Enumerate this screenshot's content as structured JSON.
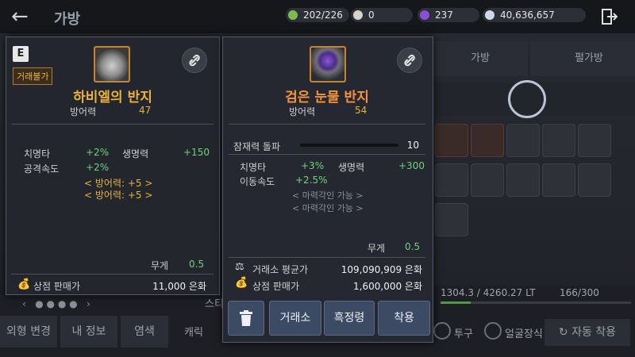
{
  "header": {
    "title": "가방",
    "currencies": [
      {
        "name": "weight-currency",
        "value": "202/226",
        "color": "#7dbb4e"
      },
      {
        "name": "pearl-currency",
        "value": "0",
        "color": "#d9d2c8"
      },
      {
        "name": "gem-currency",
        "value": "237",
        "color": "#8a4fd6"
      },
      {
        "name": "silver-currency",
        "value": "40,636,657",
        "color": "#cfd8e6"
      }
    ]
  },
  "inventory": {
    "tabs": [
      "가방",
      "펄가방"
    ],
    "weight": "1304.3 / 4260.27 LT",
    "slots": "166/300"
  },
  "bottom": {
    "buttons": [
      "외형 변경",
      "내 정보",
      "염색"
    ],
    "auto_equip": "자동 착용",
    "check_labels": [
      "투구",
      "얼굴장식"
    ],
    "partial": [
      "캐릭",
      "스티"
    ]
  },
  "left_item": {
    "grade": "E",
    "trade_badge": "거래불가",
    "name": "하비엘의 반지",
    "name_color": "#e8b23a",
    "defense_label": "방어력",
    "defense_value": "47",
    "stats": [
      {
        "label": "치명타",
        "value": "+2%"
      },
      {
        "label": "생명력",
        "value": "+150"
      },
      {
        "label": "공격속도",
        "value": "+2%"
      }
    ],
    "bonuses": [
      "< 방어력: +5 >",
      "< 방어력: +5 >"
    ],
    "weight_label": "무게",
    "weight_value": "0.5",
    "shop_label": "상점 판매가",
    "shop_value": "11,000 은화"
  },
  "right_item": {
    "name": "검은 눈물 반지",
    "name_color": "#f2933a",
    "defense_label": "방어력",
    "defense_value": "54",
    "potential_label": "잠재력 돌파",
    "potential_value": "10",
    "stats": [
      {
        "label": "치명타",
        "value": "+3%"
      },
      {
        "label": "생명력",
        "value": "+300"
      },
      {
        "label": "이동속도",
        "value": "+2.5%"
      }
    ],
    "engraves": [
      "< 마력각인 가능 >",
      "< 마력각인 가능 >"
    ],
    "weight_label": "무게",
    "weight_value": "0.5",
    "market_label": "거래소 평균가",
    "market_value": "109,090,909 은화",
    "shop_label": "상점 판매가",
    "shop_value": "1,600,000 은화",
    "actions": {
      "trade": "거래소",
      "black_spirit": "흑정령",
      "equip": "착용"
    }
  }
}
